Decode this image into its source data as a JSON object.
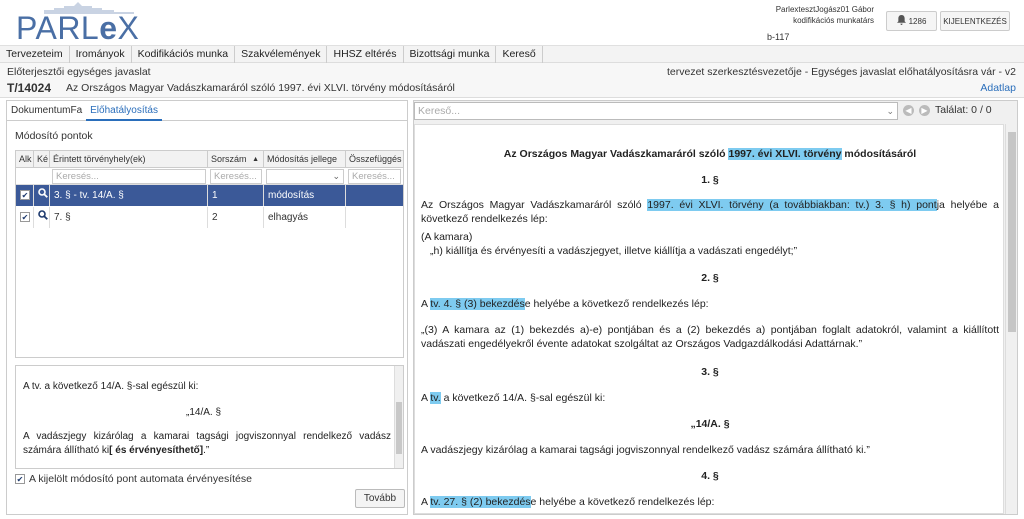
{
  "header": {
    "user_name": "ParlextesztJogász01 Gábor",
    "user_role": "kodifikációs munkatárs",
    "user_code": "b-117",
    "notif_count": "1286",
    "logout_label": "KIJELENTKEZÉS"
  },
  "nav": {
    "items": [
      "Tervezeteim",
      "Irományok",
      "Kodifikációs munka",
      "Szakvélemények",
      "HHSZ eltérés",
      "Bizottsági munka",
      "Kereső"
    ]
  },
  "doc": {
    "type": "Előterjesztői egységes javaslat",
    "number": "T/14024",
    "title": "Az Országos Magyar Vadászkamaráról szóló 1997. évi XLVI. törvény módosításáról",
    "status": "tervezet szerkesztésvezetője - Egységes javaslat előhatályosításra vár - v2",
    "adatlap": "Adatlap"
  },
  "left": {
    "tabs": [
      "DokumentumFa",
      "Előhatályosítás"
    ],
    "section_title": "Módosító pontok",
    "columns": [
      "Alk",
      "Ké",
      "Érintett törvényhely(ek)",
      "Sorszám",
      "Módosítás jellege",
      "Összefüggés"
    ],
    "filter_placeholder": "Keresés...",
    "rows": [
      {
        "hely": "3. § - tv. 14/A. §",
        "sorszam": "1",
        "jelleg": "módosítás"
      },
      {
        "hely": "7. §",
        "sorszam": "2",
        "jelleg": "elhagyás"
      }
    ],
    "detail": {
      "line1": "A tv. a következő 14/A. §-sal egészül ki:",
      "line2": "„14/A. §",
      "line3a": "A vadászjegy kizárólag a kamarai tagsági jogviszonnyal rendelkező vadász számára állítható ki",
      "line3b": "[ és érvényesíthető]",
      "line3c": ".”"
    },
    "auto_label": "A kijelölt módosító pont automata érvényesítése",
    "next_label": "Tovább"
  },
  "right": {
    "search_placeholder": "Kereső...",
    "talalat": "Találat: 0 / 0",
    "title_a": "Az Országos Magyar Vadászkamaráról szóló ",
    "title_hl": "1997. évi XLVI. törvény",
    "title_b": " módosításáról",
    "s1": "1. §",
    "p1a": "Az Országos Magyar Vadászkamaráról szóló ",
    "p1hl": "1997. évi XLVI. törvény (a továbbiakban: tv.) 3. § h) pont",
    "p1b": "ja helyébe a következő rendelkezés lép:",
    "p1c": "(A kamara)",
    "p1d": "„h) kiállítja és érvényesíti a vadászjegyet, illetve kiállítja a vadászati engedélyt;”",
    "s2": "2. §",
    "p2a": "A ",
    "p2hl": "tv. 4. § (3) bekezdés",
    "p2b": "e helyébe a következő rendelkezés lép:",
    "p2c": "„(3) A kamara az (1) bekezdés a)-e) pontjában és a (2) bekezdés a) pontjában foglalt adatokról, valamint a kiállított vadászati engedélyekről évente adatokat szolgáltat az Országos Vadgazdálkodási Adattárnak.”",
    "s3": "3. §",
    "p3a": "A ",
    "p3hl": "tv.",
    "p3b": " a következő 14/A. §-sal egészül ki:",
    "p3c": "„14/A. §",
    "p3d": "A vadászjegy kizárólag a kamarai tagsági jogviszonnyal rendelkező vadász számára állítható ki.”",
    "s4": "4. §",
    "p4a": "A ",
    "p4hl": "tv. 27. § (2) bekezdés",
    "p4b": "e helyébe a következő rendelkezés lép:"
  },
  "colors": {
    "accent": "#2a6ebb",
    "selected_row": "#3b5998",
    "highlight": "#7ecbf0",
    "logo": "#4a6fa5"
  }
}
